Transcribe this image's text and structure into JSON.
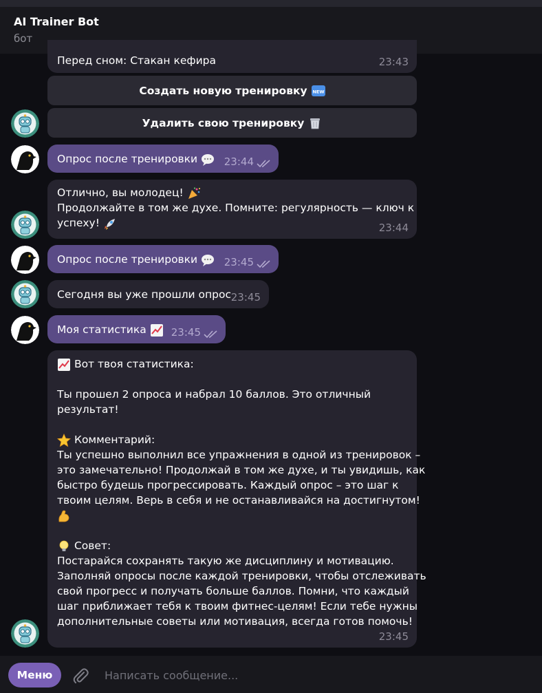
{
  "header": {
    "title": "AI Trainer Bot",
    "subtitle": "бот"
  },
  "messages": {
    "m0": {
      "text": "Перед сном: Стакан кефира",
      "time": "23:43"
    },
    "m1": {
      "text": "Опрос после тренировки",
      "time": "23:44",
      "icon": "speech-balloon"
    },
    "m2": {
      "line1": "Отлично, вы молодец!",
      "line2": "Продолжайте в том же духе. Помните: регулярность — ключ к",
      "line3": "успеху!",
      "time": "23:44"
    },
    "m3": {
      "text": "Опрос после тренировки",
      "time": "23:45",
      "icon": "speech-balloon"
    },
    "m4": {
      "text": "Сегодня вы уже прошли опрос",
      "time": "23:45"
    },
    "m5": {
      "text": "Моя статистика",
      "time": "23:45",
      "icon": "chart-increasing"
    },
    "m6": {
      "heading": "Вот твоя статистика:",
      "p1": "Ты прошел 2 опроса и набрал 10 баллов. Это отличный",
      "p2": "результат!",
      "comment_title": "Комментарий:",
      "c1": "Ты успешно выполнил все упражнения в одной из тренировок –",
      "c2": "это замечательно! Продолжай в том же духе, и ты увидишь, как",
      "c3": "быстро будешь прогрессировать. Каждый опрос – это шаг к",
      "c4": "твоим целям. Верь в себя и не останавливайся на достигнутом!",
      "advice_title": "Совет:",
      "a1": "Постарайся сохранять такую же дисциплину и мотивацию.",
      "a2": "Заполняй опросы после каждой тренировки, чтобы отслеживать",
      "a3": "свой прогресс и получать больше баллов. Помни, что каждый",
      "a4": "шаг приближает тебя к твоим фитнес-целям! Если тебе нужны",
      "a5": "дополнительные советы или мотивация, всегда готов помочь!",
      "time": "23:45"
    }
  },
  "keyboard": {
    "create_label": "Создать новую тренировку",
    "create_icon": "new-badge-icon",
    "delete_label": "Удалить свою тренировку",
    "delete_icon": "trash-icon"
  },
  "composer": {
    "menu_label": "Меню",
    "placeholder": "Написать сообщение..."
  },
  "colors": {
    "background": "#0e0e13",
    "header": "#18181d",
    "incoming_bubble": "#26242f",
    "outgoing_bubble": "#5a4b86",
    "keyboard_button": "#2b2a33",
    "menu_button": "#7a60b6",
    "timestamp": "#8e8b98"
  }
}
